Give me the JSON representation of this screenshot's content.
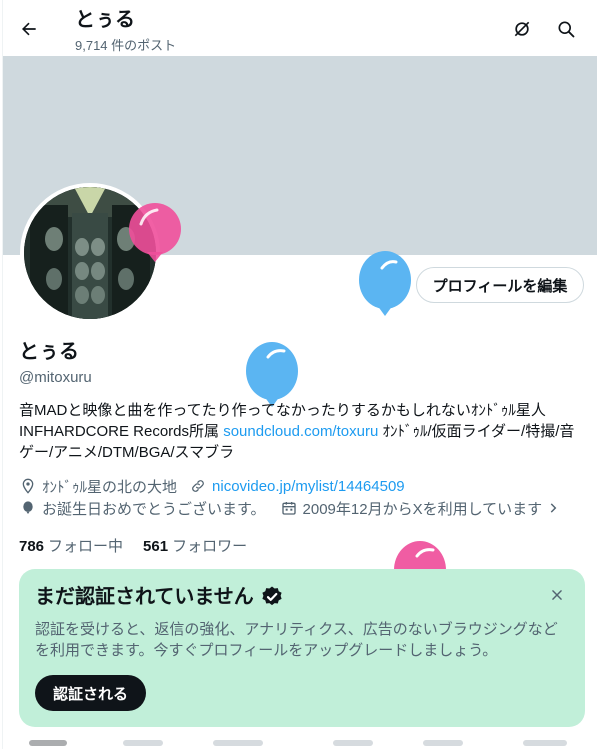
{
  "header": {
    "title": "とぅる",
    "post_count": "9,714 件のポスト",
    "back_icon": "arrow-left-icon",
    "actions": [
      "birthday-off-icon",
      "search-icon"
    ]
  },
  "profile": {
    "name": "とぅる",
    "handle": "@mitoxuru",
    "edit_button": "プロフィールを編集",
    "bio_line1": "音MADと映像と曲を作ってたり作ってなかったりするかもしれないｵﾝﾄﾞｩﾙ星人",
    "bio_line2_prefix": "INFHARDCORE Records所属 ",
    "bio_link": "soundcloud.com/toxuru",
    "bio_line2_suffix": " ｵﾝﾄﾞｩﾙ/仮面ライダー/特撮/音",
    "bio_line3": "ゲー/アニメ/DTM/BGA/スマブラ",
    "location": "ｵﾝﾄﾞｩﾙ星の北の大地",
    "website": "nicovideo.jp/mylist/14464509",
    "birthday": "お誕生日おめでとうございます。",
    "joined": "2009年12月からXを利用しています",
    "following_count": "786",
    "following_label": "フォロー中",
    "followers_count": "561",
    "followers_label": "フォロワー"
  },
  "verify_card": {
    "title": "まだ認証されていません",
    "text": "認証を受けると、返信の強化、アナリティクス、広告のないブラウジングなどを利用できます。今すぐプロフィールをアップグレードしましょう。",
    "button": "認証される"
  },
  "colors": {
    "accent": "#1d9bf0",
    "banner": "#cfd9de",
    "card_bg": "#c1efd9",
    "balloon_blue": "#5bb5f2",
    "balloon_pink": "#ef4f9b"
  }
}
